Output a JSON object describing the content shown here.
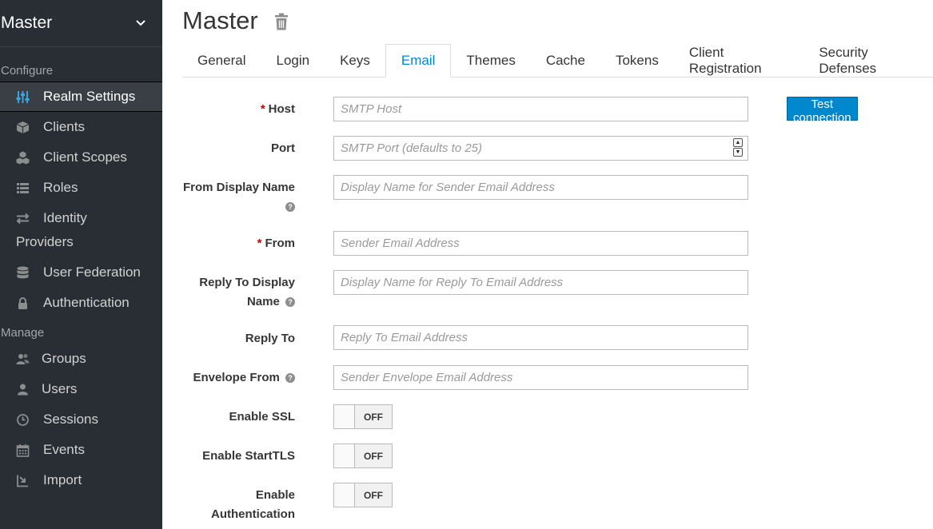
{
  "sidebar": {
    "realm": "Master",
    "configure_label": "Configure",
    "configure_items": [
      {
        "label": "Realm Settings",
        "icon": "sliders-icon",
        "active": true
      },
      {
        "label": "Clients",
        "icon": "cube-icon"
      },
      {
        "label": "Client Scopes",
        "icon": "cubes-icon"
      },
      {
        "label": "Roles",
        "icon": "list-icon"
      },
      {
        "label": "Identity",
        "label2": "Providers",
        "icon": "exchange-icon"
      },
      {
        "label": "User Federation",
        "icon": "database-icon"
      },
      {
        "label": "Authentication",
        "icon": "lock-icon"
      }
    ],
    "manage_label": "Manage",
    "manage_items": [
      {
        "label": "Groups",
        "icon": "users-icon"
      },
      {
        "label": "Users",
        "icon": "user-icon"
      },
      {
        "label": "Sessions",
        "icon": "clock-icon"
      },
      {
        "label": "Events",
        "icon": "calendar-icon"
      },
      {
        "label": "Import",
        "icon": "import-icon"
      }
    ]
  },
  "header": {
    "title": "Master"
  },
  "tabs": [
    {
      "label": "General"
    },
    {
      "label": "Login"
    },
    {
      "label": "Keys"
    },
    {
      "label": "Email",
      "active": true
    },
    {
      "label": "Themes"
    },
    {
      "label": "Cache"
    },
    {
      "label": "Tokens"
    },
    {
      "label": "Client Registration"
    },
    {
      "label": "Security Defenses"
    }
  ],
  "form": {
    "host": {
      "label": "Host",
      "required": "*",
      "placeholder": "SMTP Host"
    },
    "port": {
      "label": "Port",
      "placeholder": "SMTP Port (defaults to 25)"
    },
    "from_display_name": {
      "label": "From Display Name",
      "placeholder": "Display Name for Sender Email Address"
    },
    "from": {
      "label": "From",
      "required": "*",
      "placeholder": "Sender Email Address"
    },
    "reply_to_display_name": {
      "label1": "Reply To Display",
      "label2": "Name",
      "placeholder": "Display Name for Reply To Email Address"
    },
    "reply_to": {
      "label": "Reply To",
      "placeholder": "Reply To Email Address"
    },
    "envelope_from": {
      "label": "Envelope From",
      "placeholder": "Sender Envelope Email Address"
    },
    "enable_ssl": {
      "label": "Enable SSL",
      "state": "OFF"
    },
    "enable_starttls": {
      "label": "Enable StartTLS",
      "state": "OFF"
    },
    "enable_auth": {
      "label1": "Enable",
      "label2": "Authentication",
      "state": "OFF"
    },
    "help_glyph": "?"
  },
  "test_button": "Test connection",
  "colors": {
    "accent": "#0088ce",
    "sidebar_bg": "#292e34",
    "required": "#cc0000"
  }
}
